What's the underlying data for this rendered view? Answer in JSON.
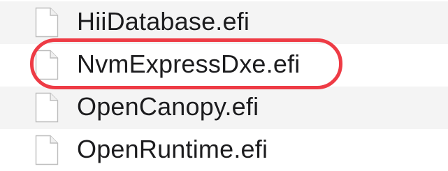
{
  "files": [
    {
      "name": "HiiDatabase.efi",
      "icon": "document-icon",
      "striped": true
    },
    {
      "name": "NvmExpressDxe.efi",
      "icon": "document-icon",
      "striped": false
    },
    {
      "name": "OpenCanopy.efi",
      "icon": "document-icon",
      "striped": true
    },
    {
      "name": "OpenRuntime.efi",
      "icon": "document-icon",
      "striped": false
    }
  ],
  "colors": {
    "row_stripe": "#f4f4f4",
    "highlight": "#ee3b45",
    "text": "#1c1c1e"
  }
}
